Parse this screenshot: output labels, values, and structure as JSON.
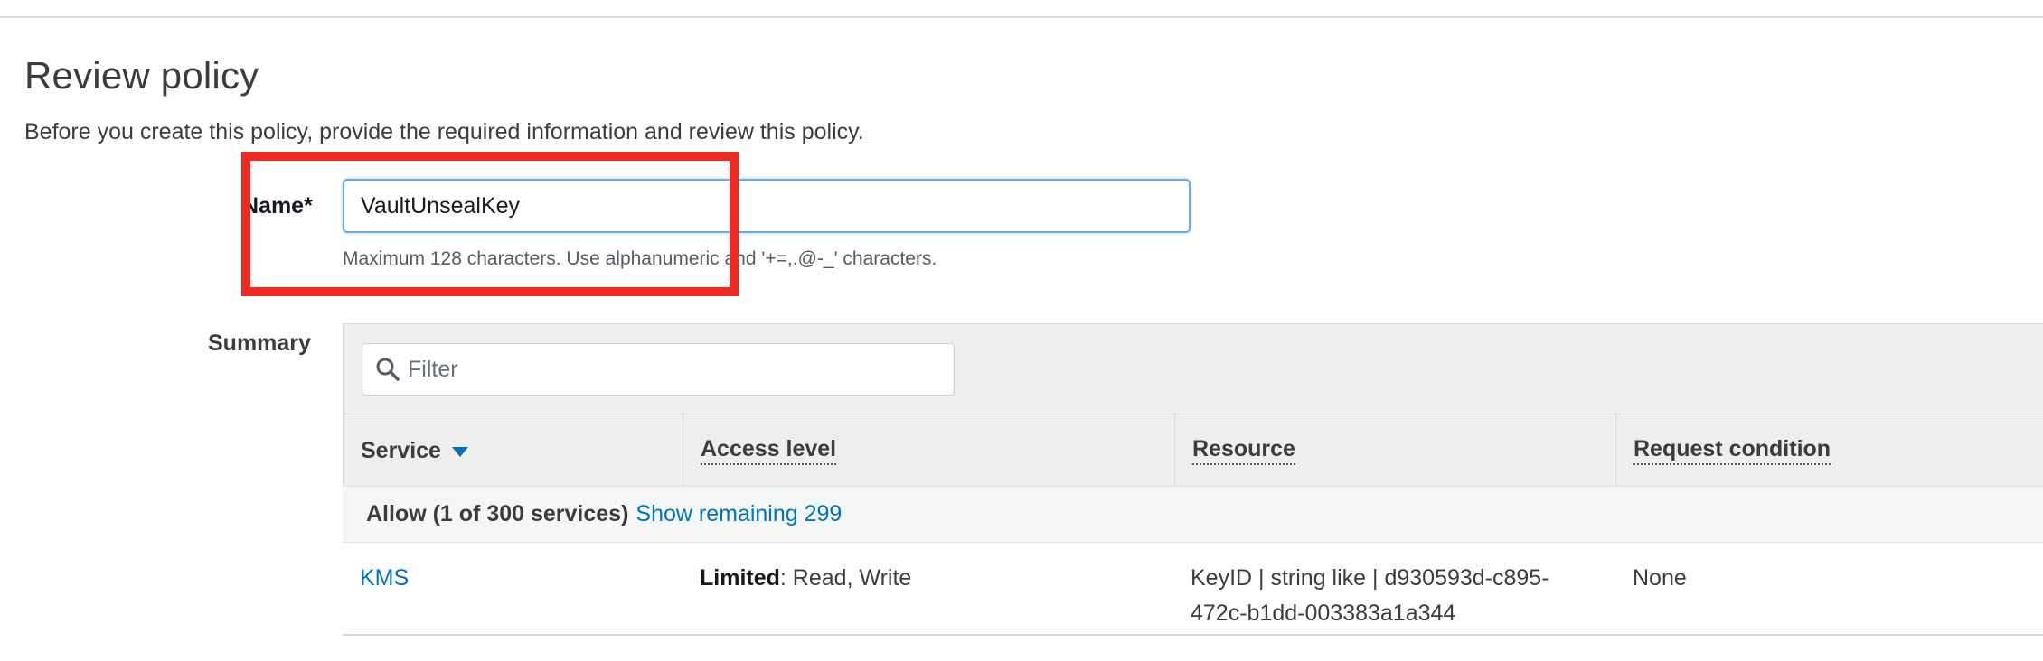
{
  "page": {
    "title": "Review policy",
    "description": "Before you create this policy, provide the required information and review this policy."
  },
  "name_field": {
    "label": "Name*",
    "value": "VaultUnsealKey",
    "hint": "Maximum 128 characters. Use alphanumeric and '+=,.@-_' characters."
  },
  "summary": {
    "label": "Summary",
    "filter": {
      "placeholder": "Filter",
      "icon": "search-icon"
    },
    "columns": [
      "Service",
      "Access level",
      "Resource",
      "Request condition"
    ],
    "sort_icon": "caret-down-icon",
    "group": {
      "text": "Allow (1 of 300 services)",
      "link": "Show remaining 299"
    },
    "rows": [
      {
        "service": "KMS",
        "access_level_bold": "Limited",
        "access_level_rest": ": Read, Write",
        "resource_line1": "KeyID | string like | d930593d-c895-",
        "resource_line2": "472c-b1dd-003383a1a344",
        "request_condition": "None"
      }
    ]
  },
  "colors": {
    "link": "#0073bb",
    "highlight": "#ee2a24",
    "focus_border": "#6ea6e8"
  }
}
